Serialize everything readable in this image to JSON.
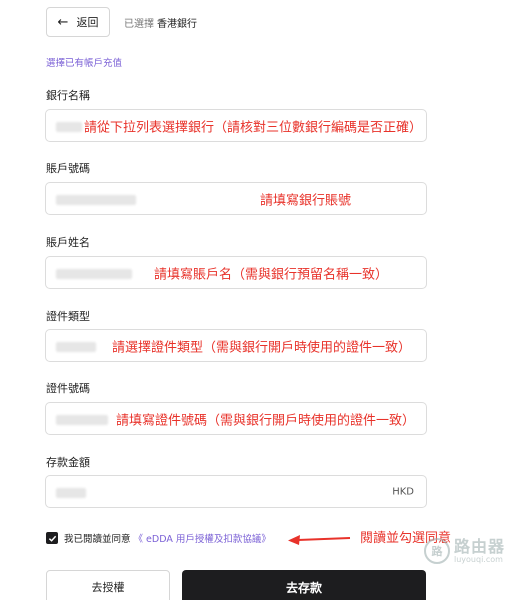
{
  "header": {
    "back_label": "返回",
    "selected_prefix": "已選擇",
    "selected_bank": "香港銀行"
  },
  "section_title": "選擇已有帳戶充值",
  "fields": {
    "bank_name": {
      "label": "銀行名稱",
      "hint": "請從下拉列表選擇銀行（請核對三位數銀行編碼是否正確）"
    },
    "account_number": {
      "label": "賬戶號碼",
      "hint": "請填寫銀行賬號"
    },
    "account_name": {
      "label": "賬戶姓名",
      "hint": "請填寫賬戶名（需與銀行預留名稱一致）"
    },
    "id_type": {
      "label": "證件類型",
      "hint": "請選擇證件類型（需與銀行開戶時使用的證件一致）"
    },
    "id_number": {
      "label": "證件號碼",
      "hint": "請填寫證件號碼（需與銀行開戶時使用的證件一致）"
    },
    "amount": {
      "label": "存款金額",
      "currency": "HKD"
    }
  },
  "agreement": {
    "checked": true,
    "text": "我已閱讀並同意",
    "link": "《 eDDA 用戶授權及扣款協議》",
    "annotation": "閱讀並勾選同意"
  },
  "actions": {
    "deauthorize": "去授權",
    "deposit": "去存款"
  },
  "watermark": {
    "logo_text": "路",
    "name": "路由器",
    "url": "luyouqi.com"
  }
}
